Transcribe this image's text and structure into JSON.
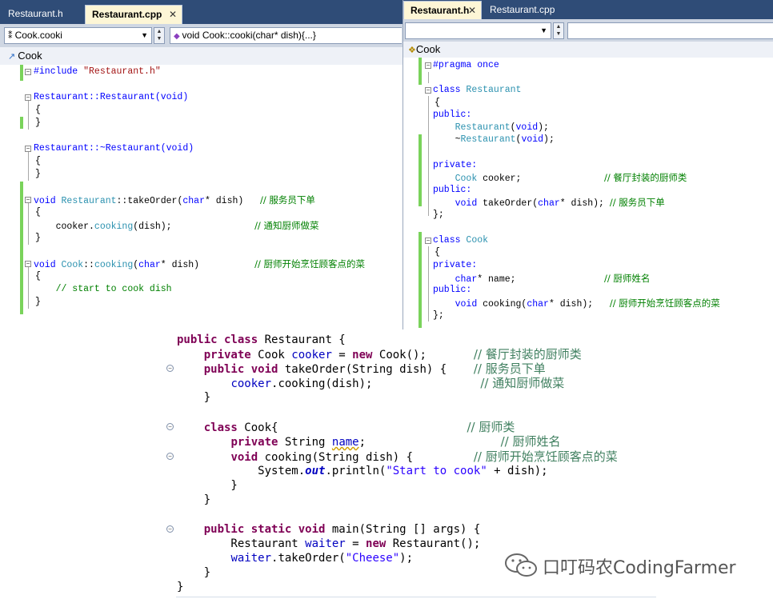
{
  "left_editor": {
    "tabs": [
      "Restaurant.h",
      "Restaurant.cpp"
    ],
    "active_tab": "Restaurant.cpp",
    "close_glyph": "✕",
    "scope_dropdown": "Cook.cooki",
    "member_dropdown": "void Cook::cooki(char* dish){...}",
    "class_bar": "Cook",
    "code": {
      "l1_a": "#include ",
      "l1_b": "\"Restaurant.h\"",
      "l2": "Restaurant::Restaurant(void)",
      "l3": "{",
      "l4": "}",
      "l5": "Restaurant::~Restaurant(void)",
      "l6": "{",
      "l7": "}",
      "l8_a": "void ",
      "l8_b": "Restaurant",
      "l8_c": "::takeOrder(",
      "l8_d": "char",
      "l8_e": "* dish)   ",
      "l8_f": "// 服务员下单",
      "l9": "{",
      "l10_a": "    cooker.",
      "l10_b": "cooking",
      "l10_c": "(dish);               ",
      "l10_d": "// 通知厨师做菜",
      "l11": "}",
      "l12_a": "void ",
      "l12_b": "Cook",
      "l12_c": "::",
      "l12_d": "cooking",
      "l12_e": "(",
      "l12_f": "char",
      "l12_g": "* dish)          ",
      "l12_h": "// 厨师开始烹饪顾客点的菜",
      "l13": "{",
      "l14": "    // start to cook dish",
      "l15": "}"
    }
  },
  "right_editor": {
    "tabs": [
      "Restaurant.h",
      "Restaurant.cpp"
    ],
    "active_tab": "Restaurant.h",
    "close_glyph": "✕",
    "scope_dropdown": "",
    "class_bar": "Cook",
    "code": {
      "r1": "#pragma once",
      "r2_a": "class ",
      "r2_b": "Restaurant",
      "r3": "{",
      "r4": "public:",
      "r5_a": "    ",
      "r5_b": "Restaurant",
      "r5_c": "(",
      "r5_d": "void",
      "r5_e": ");",
      "r6_a": "    ~",
      "r6_b": "Restaurant",
      "r6_c": "(",
      "r6_d": "void",
      "r6_e": ");",
      "r7": "private:",
      "r8_a": "    ",
      "r8_b": "Cook",
      "r8_c": " cooker;               ",
      "r8_d": "// 餐厅封装的厨师类",
      "r9": "public:",
      "r10_a": "    ",
      "r10_b": "void",
      "r10_c": " takeOrder(",
      "r10_d": "char",
      "r10_e": "* dish); ",
      "r10_f": "// 服务员下单",
      "r11": "};",
      "r12_a": "class ",
      "r12_b": "Cook",
      "r13": "{",
      "r14": "private:",
      "r15_a": "    ",
      "r15_b": "char",
      "r15_c": "* name;                ",
      "r15_d": "// 厨师姓名",
      "r16": "public:",
      "r17_a": "    ",
      "r17_b": "void",
      "r17_c": " cooking(",
      "r17_d": "char",
      "r17_e": "* dish);   ",
      "r17_f": "// 厨师开始烹饪顾客点的菜",
      "r18": "};"
    }
  },
  "java_editor": {
    "code": {
      "j1_a": "public class",
      "j1_b": " Restaurant {",
      "j2_a": "    private",
      "j2_b": " Cook ",
      "j2_c": "cooker",
      "j2_d": " = ",
      "j2_e": "new",
      "j2_f": " Cook();       ",
      "j2_g": "// 餐厅封装的厨师类",
      "j3_a": "    public void",
      "j3_b": " takeOrder(String dish) {    ",
      "j3_c": "// 服务员下单",
      "j4_a": "        ",
      "j4_b": "cooker",
      "j4_c": ".cooking(dish);                ",
      "j4_d": "// 通知厨师做菜",
      "j5": "    }",
      "j6_a": "    ",
      "j6_b": "class",
      "j6_c": " Cook{                            ",
      "j6_d": "// 厨师类",
      "j7_a": "        ",
      "j7_b": "private",
      "j7_c": " String ",
      "j7_d": "name",
      "j7_e": ";                    ",
      "j7_f": "// 厨师姓名",
      "j8_a": "        ",
      "j8_b": "void",
      "j8_c": " cooking(String dish) {         ",
      "j8_d": "// 厨师开始烹饪顾客点的菜",
      "j9_a": "            System.",
      "j9_b": "out",
      "j9_c": ".println(",
      "j9_d": "\"Start to cook\"",
      "j9_e": " + dish);",
      "j10": "        }",
      "j11": "    }",
      "j12_a": "    public static void",
      "j12_b": " main(String [] args) {",
      "j13_a": "        Restaurant ",
      "j13_b": "waiter",
      "j13_c": " = ",
      "j13_d": "new",
      "j13_e": " Restaurant();",
      "j14_a": "        ",
      "j14_b": "waiter",
      "j14_c": ".takeOrder(",
      "j14_d": "\"Cheese\"",
      "j14_e": ");",
      "j15": "    }",
      "j16": "}"
    },
    "watermark": "口叮码农CodingFarmer"
  },
  "colors": {
    "vs_tab_bar": "#2f4c77",
    "vs_keyword": "#0000ff",
    "vs_type": "#2b91af",
    "vs_comment": "#008000",
    "java_keyword": "#7f0055",
    "java_field": "#0000c0",
    "java_string": "#2a00ff",
    "java_comment": "#3f7f5f",
    "change_bar": "#7ad35b"
  },
  "icons": [
    "scope-icon",
    "method-icon",
    "class-icon",
    "fold-toggle-icon",
    "wechat-logo-icon"
  ]
}
